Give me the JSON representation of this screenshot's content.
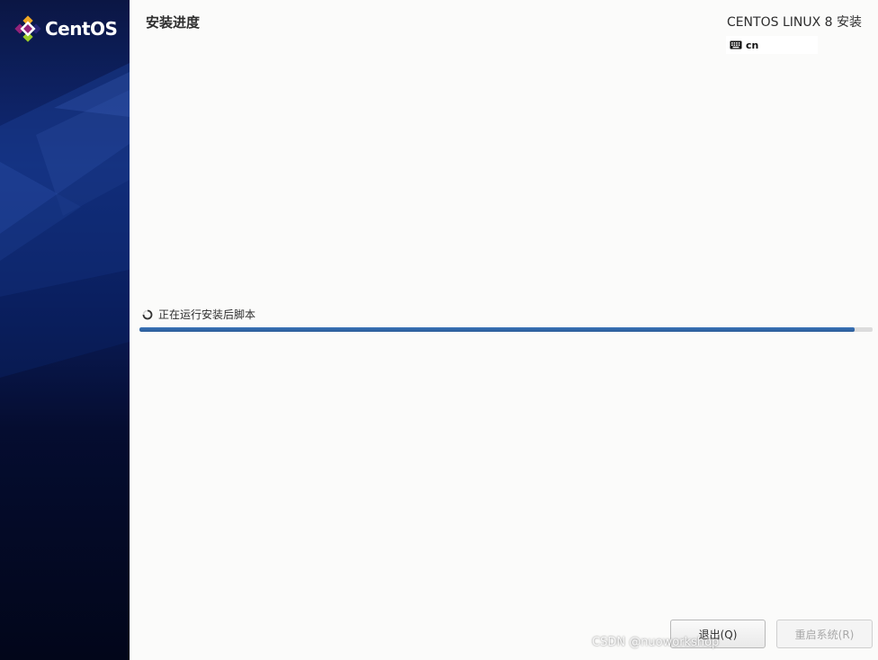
{
  "sidebar": {
    "logo_text": "CentOS"
  },
  "header": {
    "title": "安装进度",
    "product": "CENTOS LINUX 8 安装",
    "keyboard_layout": "cn"
  },
  "progress": {
    "status_text": "正在运行安装后脚本",
    "value": 0.975
  },
  "buttons": {
    "quit_label": "退出(Q)",
    "reboot_label": "重启系统(R)"
  },
  "watermark": "CSDN @nuoworkshop",
  "colors": {
    "progress_fill": "#2a5c98",
    "sidebar_dark": "#02061a",
    "sidebar_blue": "#0f2a78",
    "content_bg": "#fbfbfa"
  },
  "icons": {
    "logo": "centos-logo-icon",
    "keyboard": "keyboard-icon",
    "spinner": "spinner-icon"
  }
}
